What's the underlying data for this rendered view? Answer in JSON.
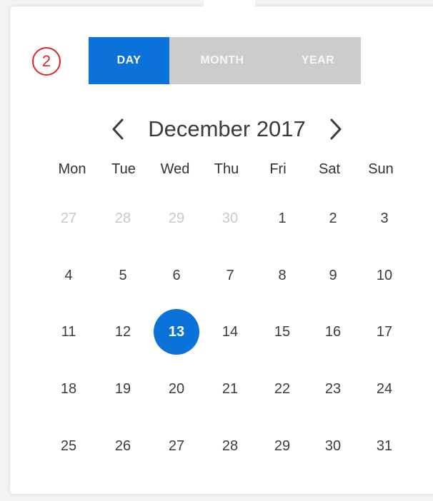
{
  "step_badge": "2",
  "view_switcher": {
    "day": "DAY",
    "month": "MONTH",
    "year": "YEAR",
    "selected": "DAY"
  },
  "header": {
    "title": "December 2017",
    "prev_icon": "chevron-left-icon",
    "next_icon": "chevron-right-icon"
  },
  "weekdays": [
    "Mon",
    "Tue",
    "Wed",
    "Thu",
    "Fri",
    "Sat",
    "Sun"
  ],
  "weeks": [
    [
      "27",
      "28",
      "29",
      "30",
      "1",
      "2",
      "3"
    ],
    [
      "4",
      "5",
      "6",
      "7",
      "8",
      "9",
      "10"
    ],
    [
      "11",
      "12",
      "13",
      "14",
      "15",
      "16",
      "17"
    ],
    [
      "18",
      "19",
      "20",
      "21",
      "22",
      "23",
      "24"
    ],
    [
      "25",
      "26",
      "27",
      "28",
      "29",
      "30",
      "31"
    ]
  ],
  "selected_day": "13",
  "colors": {
    "accent": "#0a72d8",
    "badge": "#e5232b",
    "muted_text": "#c9c9c9"
  }
}
